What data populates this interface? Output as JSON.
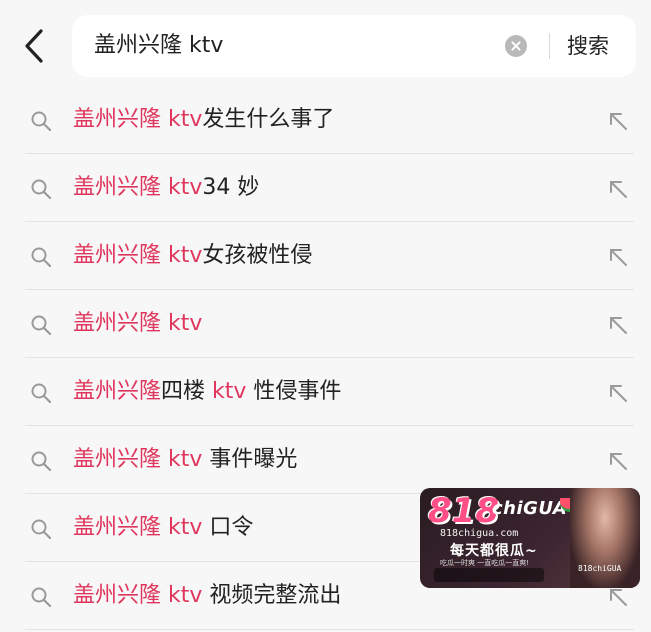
{
  "search": {
    "query": "盖州兴隆 ktv",
    "search_label": "搜索"
  },
  "suggestions": [
    {
      "parts": [
        {
          "text": "盖州兴隆 ktv",
          "hl": true
        },
        {
          "text": "发生什么事了",
          "hl": false
        }
      ]
    },
    {
      "parts": [
        {
          "text": "盖州兴隆 ktv",
          "hl": true
        },
        {
          "text": "34 妙",
          "hl": false
        }
      ]
    },
    {
      "parts": [
        {
          "text": "盖州兴隆 ktv",
          "hl": true
        },
        {
          "text": "女孩被性侵",
          "hl": false
        }
      ]
    },
    {
      "parts": [
        {
          "text": "盖州兴隆 ktv",
          "hl": true
        }
      ]
    },
    {
      "parts": [
        {
          "text": "盖州兴隆",
          "hl": true
        },
        {
          "text": "四楼 ",
          "hl": false
        },
        {
          "text": "ktv",
          "hl": true
        },
        {
          "text": " 性侵事件",
          "hl": false
        }
      ]
    },
    {
      "parts": [
        {
          "text": "盖州兴隆 ktv",
          "hl": true
        },
        {
          "text": " 事件曝光",
          "hl": false
        }
      ]
    },
    {
      "parts": [
        {
          "text": "盖州兴隆 ktv",
          "hl": true
        },
        {
          "text": " 口令",
          "hl": false
        }
      ]
    },
    {
      "parts": [
        {
          "text": "盖州兴隆 ktv",
          "hl": true
        },
        {
          "text": " 视频完整流出",
          "hl": false
        }
      ]
    }
  ],
  "watermark": {
    "logo": "818",
    "logo_suffix": "chiGUA",
    "site": "818chigua.com",
    "slogan": "每天都很瓜~",
    "tagline": "吃瓜一时爽 一直吃瓜一直爽!",
    "badge": "818chiGUA"
  },
  "colors": {
    "highlight": "#e0365e",
    "text": "#222222",
    "background": "#f7f7f7"
  },
  "icons": {
    "back": "chevron-left-icon",
    "clear": "clear-icon",
    "search": "search-icon",
    "fill": "arrow-up-left-icon"
  }
}
